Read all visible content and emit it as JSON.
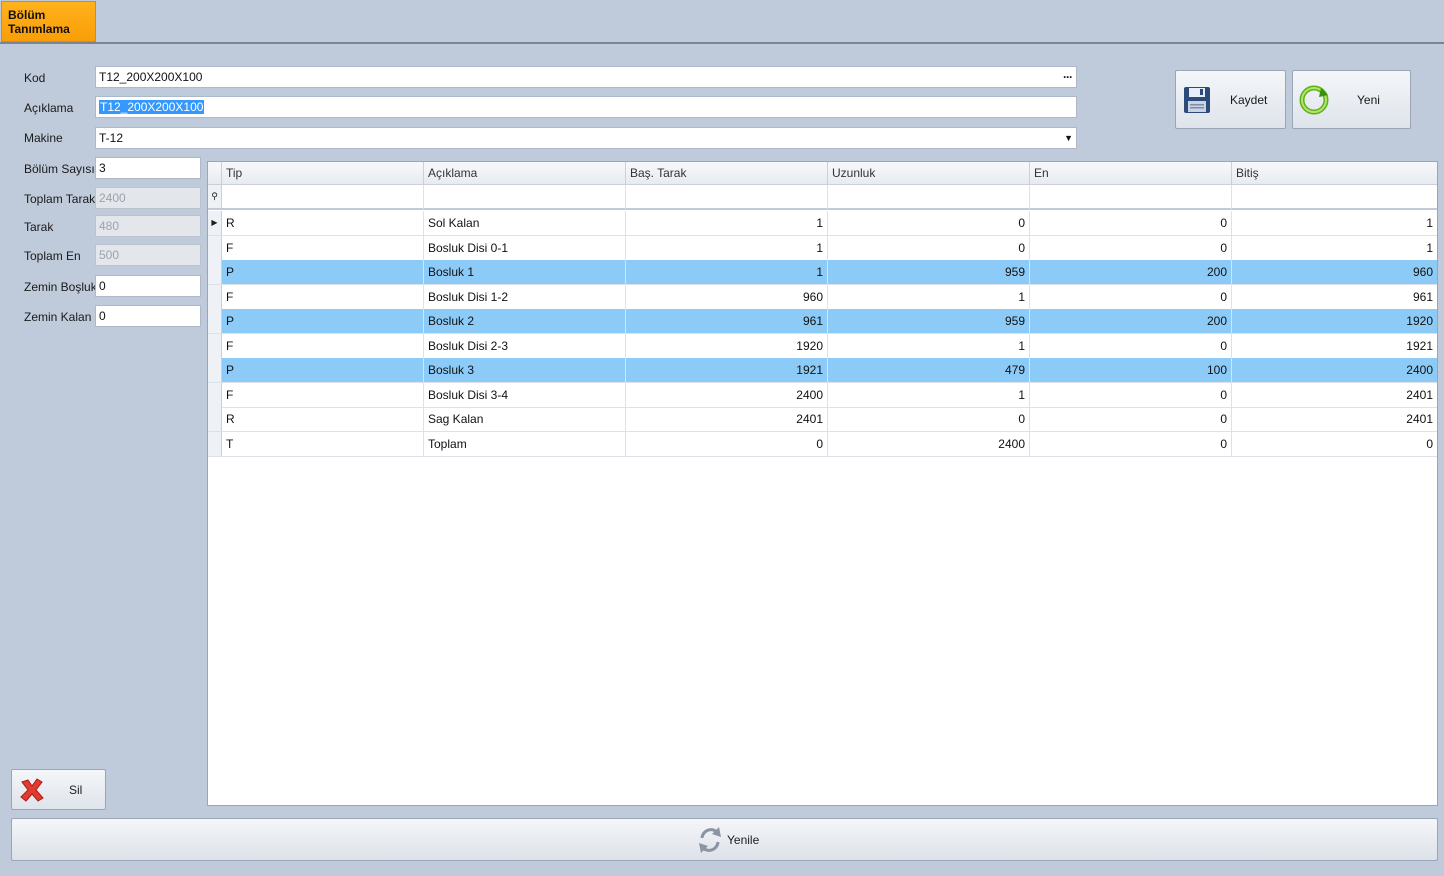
{
  "tab": {
    "label": "Bölüm\nTanımlama"
  },
  "form": {
    "kod": {
      "label": "Kod",
      "value": "T12_200X200X100"
    },
    "aciklama": {
      "label": "Açıklama",
      "value": "T12_200X200X100"
    },
    "makine": {
      "label": "Makine",
      "value": "T-12"
    },
    "bolum_sayisi": {
      "label": "Bölüm Sayısı",
      "value": "3"
    },
    "toplam_tarak": {
      "label": "Toplam Tarak",
      "value": "2400"
    },
    "tarak": {
      "label": "Tarak",
      "value": "480"
    },
    "toplam_en": {
      "label": "Toplam En",
      "value": "500"
    },
    "zemin_bosluk": {
      "label": "Zemin Boşluk",
      "value": "0"
    },
    "zemin_kalan": {
      "label": "Zemin Kalan",
      "value": "0"
    }
  },
  "buttons": {
    "kaydet": "Kaydet",
    "yeni": "Yeni",
    "sil": "Sil",
    "yenile": "Yenile"
  },
  "grid": {
    "columns": [
      "Tip",
      "Açıklama",
      "Baş. Tarak",
      "Uzunluk",
      "En",
      "Bitiş"
    ],
    "rows": [
      {
        "tip": "R",
        "aciklama": "Sol Kalan",
        "bas_tarak": "1",
        "uzunluk": "0",
        "en": "0",
        "bitis": "1",
        "selected": false
      },
      {
        "tip": "F",
        "aciklama": "Bosluk Disi 0-1",
        "bas_tarak": "1",
        "uzunluk": "0",
        "en": "0",
        "bitis": "1",
        "selected": false
      },
      {
        "tip": "P",
        "aciklama": "Bosluk 1",
        "bas_tarak": "1",
        "uzunluk": "959",
        "en": "200",
        "bitis": "960",
        "selected": true
      },
      {
        "tip": "F",
        "aciklama": "Bosluk Disi 1-2",
        "bas_tarak": "960",
        "uzunluk": "1",
        "en": "0",
        "bitis": "961",
        "selected": false
      },
      {
        "tip": "P",
        "aciklama": "Bosluk 2",
        "bas_tarak": "961",
        "uzunluk": "959",
        "en": "200",
        "bitis": "1920",
        "selected": true
      },
      {
        "tip": "F",
        "aciklama": "Bosluk Disi 2-3",
        "bas_tarak": "1920",
        "uzunluk": "1",
        "en": "0",
        "bitis": "1921",
        "selected": false
      },
      {
        "tip": "P",
        "aciklama": "Bosluk 3",
        "bas_tarak": "1921",
        "uzunluk": "479",
        "en": "100",
        "bitis": "2400",
        "selected": true
      },
      {
        "tip": "F",
        "aciklama": "Bosluk Disi 3-4",
        "bas_tarak": "2400",
        "uzunluk": "1",
        "en": "0",
        "bitis": "2401",
        "selected": false
      },
      {
        "tip": "R",
        "aciklama": "Sag Kalan",
        "bas_tarak": "2401",
        "uzunluk": "0",
        "en": "0",
        "bitis": "2401",
        "selected": false
      },
      {
        "tip": "T",
        "aciklama": "Toplam",
        "bas_tarak": "0",
        "uzunluk": "2400",
        "en": "0",
        "bitis": "0",
        "selected": false
      }
    ]
  },
  "colors": {
    "background": "#bfcadb",
    "tab_active": "#f99e06",
    "row_highlight": "#8ccbf8",
    "selection": "#3399ff"
  },
  "icons": {
    "save": "floppy-disk-icon",
    "new": "refresh-green-icon",
    "delete": "red-x-icon",
    "refresh": "refresh-arrows-icon"
  }
}
